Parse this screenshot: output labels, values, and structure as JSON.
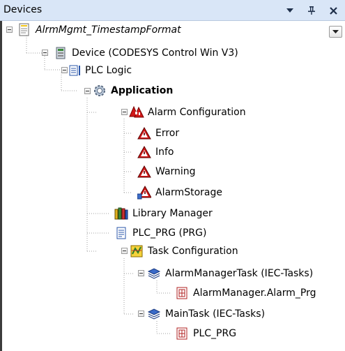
{
  "panel": {
    "title": "Devices",
    "buttons": [
      "chevron-down-icon",
      "pin-icon",
      "close-icon"
    ]
  },
  "tree": {
    "project": "AlrmMgmt_TimestampFormat",
    "device": "Device (CODESYS Control Win V3)",
    "plc_logic": "PLC Logic",
    "application": "Application",
    "alarm_configuration": "Alarm Configuration",
    "alarm_classes": [
      "Error",
      "Info",
      "Warning"
    ],
    "alarm_storage": "AlarmStorage",
    "library_manager": "Library Manager",
    "plc_prg": "PLC_PRG (PRG)",
    "task_configuration": "Task Configuration",
    "alarm_manager_task": "AlarmManagerTask (IEC-Tasks)",
    "alarm_manager_prg": "AlarmManager.Alarm_Prg",
    "main_task": "MainTask (IEC-Tasks)",
    "main_task_prg": "PLC_PRG"
  },
  "colors": {
    "titlebar": "#d9e6f7",
    "tree_line": "#a0a0a0",
    "alarm_red": "#d01818"
  }
}
